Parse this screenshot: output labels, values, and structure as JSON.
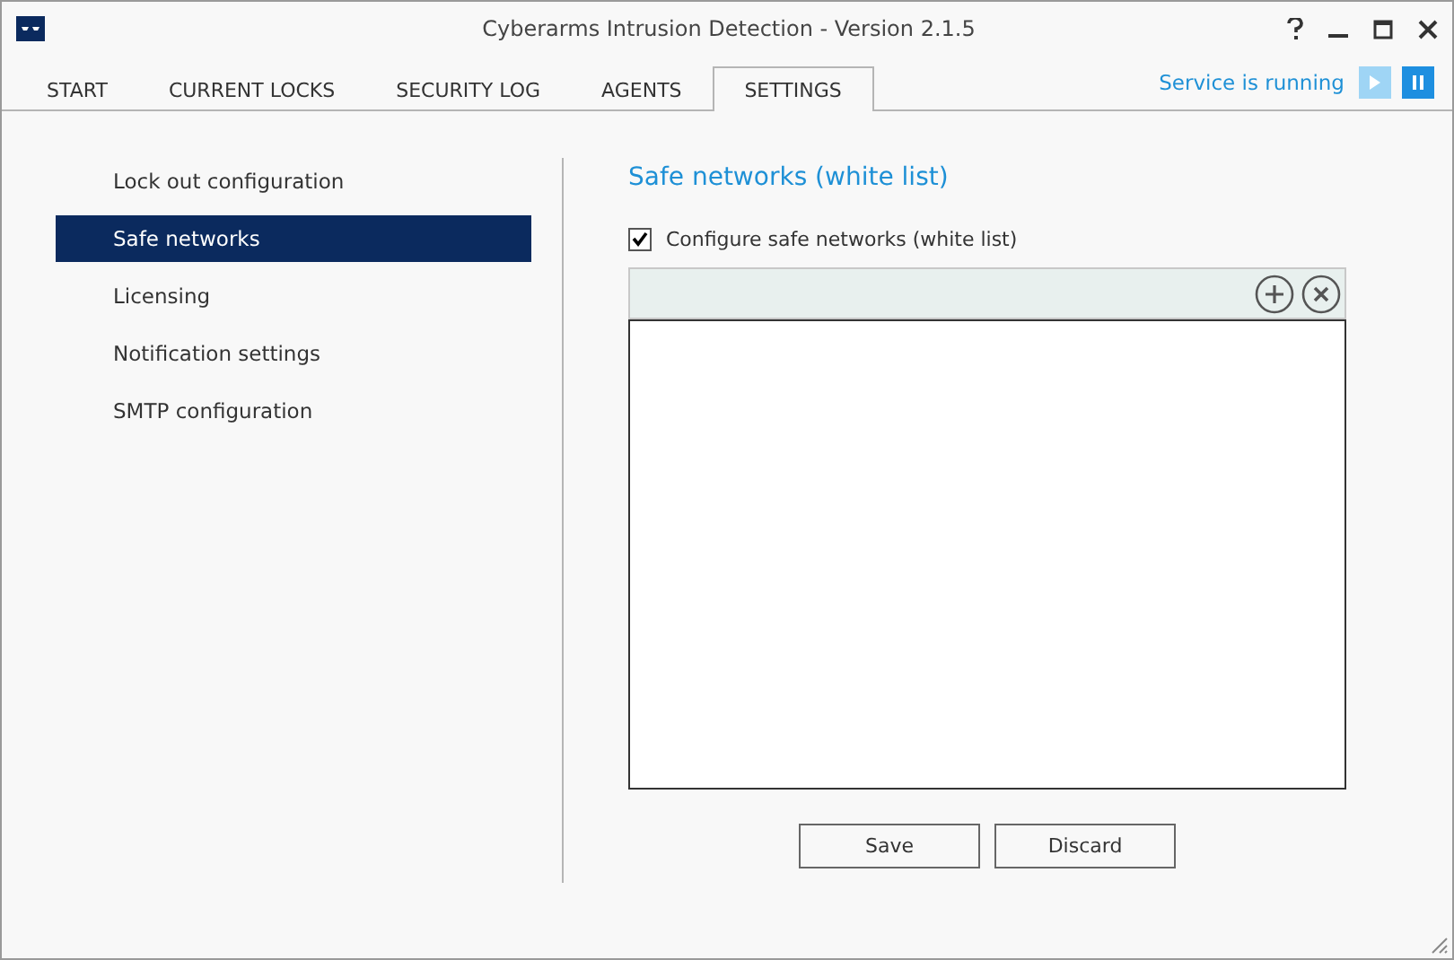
{
  "window": {
    "title": "Cyberarms Intrusion Detection - Version 2.1.5"
  },
  "tabs": [
    {
      "label": "START",
      "selected": false
    },
    {
      "label": "CURRENT LOCKS",
      "selected": false
    },
    {
      "label": "SECURITY LOG",
      "selected": false
    },
    {
      "label": "AGENTS",
      "selected": false
    },
    {
      "label": "SETTINGS",
      "selected": true
    }
  ],
  "service": {
    "status": "Service is running",
    "controls": [
      {
        "kind": "play",
        "disabled": true
      },
      {
        "kind": "pause",
        "disabled": false
      }
    ]
  },
  "sidebar": {
    "items": [
      {
        "label": "Lock out configuration",
        "selected": false
      },
      {
        "label": "Safe networks",
        "selected": true
      },
      {
        "label": "Licensing",
        "selected": false
      },
      {
        "label": "Notification settings",
        "selected": false
      },
      {
        "label": "SMTP configuration",
        "selected": false
      }
    ]
  },
  "panel": {
    "heading": "Safe networks (white list)",
    "checkbox": {
      "label": "Configure safe networks (white list)",
      "checked": true
    },
    "buttons": [
      "Save",
      "Discard"
    ]
  }
}
